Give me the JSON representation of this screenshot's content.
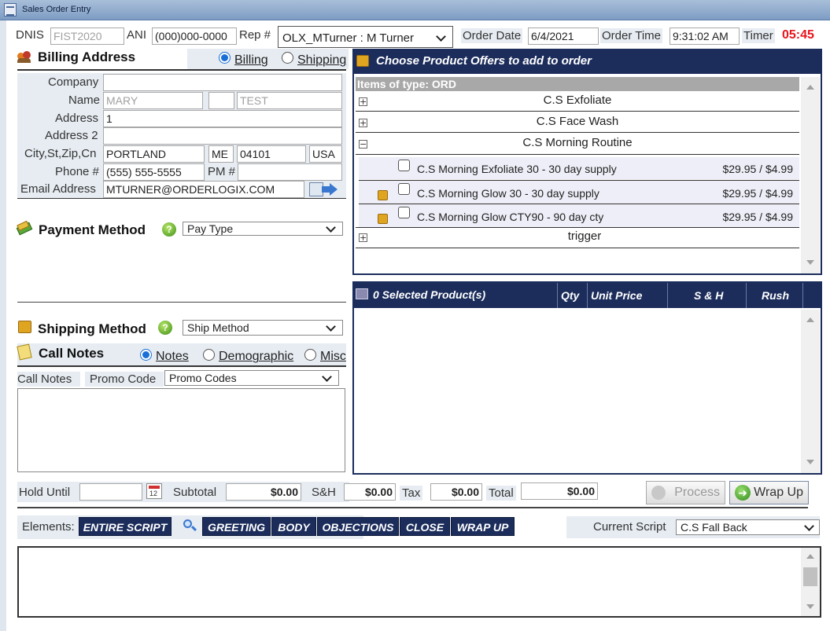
{
  "window": {
    "title": "Sales Order Entry"
  },
  "header": {
    "dnis_label": "DNIS",
    "dnis_value": "FIST2020",
    "ani_label": "ANI",
    "ani_value": "(000)000-0000",
    "rep_label": "Rep #",
    "rep_value": "OLX_MTurner : M Turner",
    "order_date_label": "Order Date",
    "order_date_value": "6/4/2021",
    "order_time_label": "Order Time",
    "order_time_value": "9:31:02 AM",
    "timer_label": "Timer",
    "timer_value": "05:45",
    "timer_color": "#e8141c"
  },
  "billing": {
    "title": "Billing Address",
    "radio_billing": "Billing",
    "radio_shipping": "Shipping",
    "company_label": "Company",
    "company_value": "",
    "name_label": "Name",
    "first_name": "MARY",
    "middle": "",
    "last_name": "TEST",
    "address_label": "Address",
    "address_value": "1",
    "address2_label": "Address 2",
    "address2_value": "",
    "city_label": "City,St,Zip,Cn",
    "city": "PORTLAND",
    "state": "ME",
    "zip": "04101",
    "country": "USA",
    "phone_label": "Phone #",
    "phone_value": "(555) 555-5555",
    "pm_label": "PM #",
    "pm_value": "",
    "email_label": "Email Address",
    "email_value": "MTURNER@ORDERLOGIX.COM"
  },
  "payment": {
    "title": "Payment Method",
    "select": "Pay Type"
  },
  "shipping": {
    "title": "Shipping Method",
    "select": "Ship Method"
  },
  "call_notes": {
    "title": "Call Notes",
    "radio_notes": "Notes",
    "radio_demographic": "Demographic",
    "radio_misc": "Misc",
    "notes_label": "Call Notes",
    "promo_label": "Promo Code",
    "promo_select": "Promo Codes"
  },
  "products": {
    "title": "Choose Product Offers to add to order",
    "items_header": "Items of type: ORD",
    "groups": [
      {
        "name": "C.S Exfoliate",
        "expander": "+"
      },
      {
        "name": "C.S Face Wash",
        "expander": "+"
      },
      {
        "name": "C.S Morning Routine",
        "expander": "−"
      },
      {
        "name": "trigger",
        "expander": "+"
      }
    ],
    "items": [
      {
        "name": "C.S Morning Exfoliate 30 - 30 day supply",
        "price": "$29.95 / $4.99"
      },
      {
        "name": "C.S Morning Glow 30 - 30 day supply",
        "price": "$29.95 / $4.99"
      },
      {
        "name": "C.S Morning Glow CTY90 - 90 day cty",
        "price": "$29.95 / $4.99"
      }
    ]
  },
  "selected": {
    "title": "0 Selected Product(s)",
    "cols": [
      "Qty",
      "Unit Price",
      "S & H",
      "Rush"
    ]
  },
  "totals": {
    "hold_label": "Hold Until",
    "hold_value": "",
    "subtotal_label": "Subtotal",
    "subtotal_value": "$0.00",
    "sh_label": "S&H",
    "sh_value": "$0.00",
    "tax_label": "Tax",
    "tax_value": "$0.00",
    "total_label": "Total",
    "total_value": "$0.00",
    "process_label": "Process",
    "wrapup_label": "Wrap Up"
  },
  "script": {
    "elements_label": "Elements:",
    "buttons": [
      "ENTIRE SCRIPT",
      "GREETING",
      "BODY",
      "OBJECTIONS",
      "CLOSE",
      "WRAP UP"
    ],
    "current_label": "Current Script",
    "current_value": "C.S Fall Back"
  }
}
